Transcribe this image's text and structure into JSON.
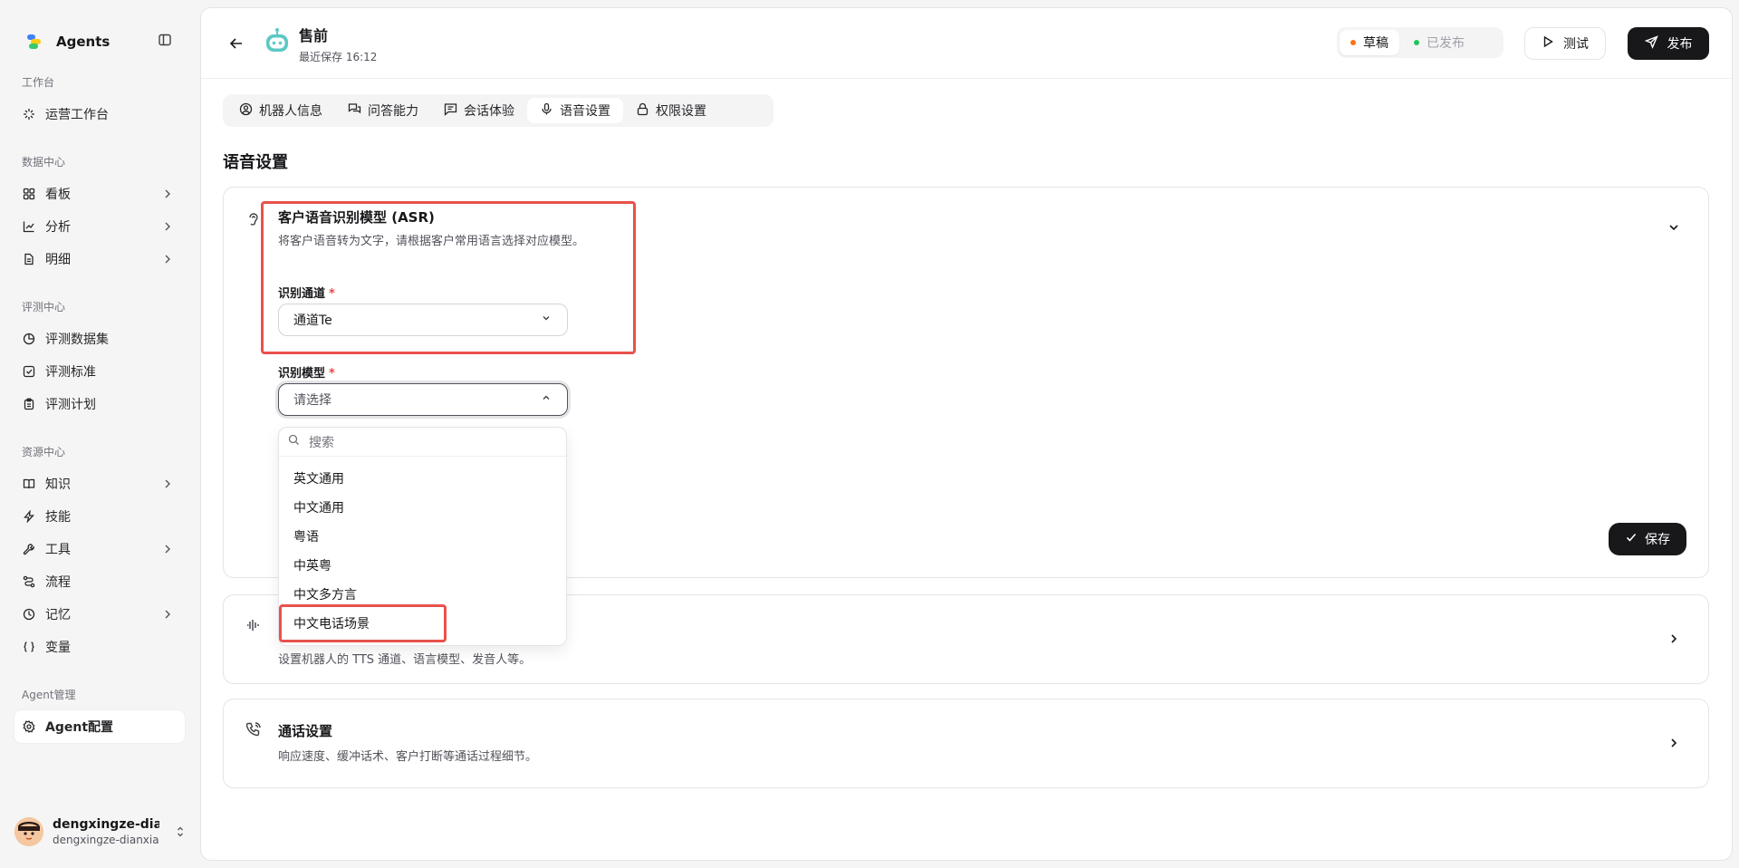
{
  "sidebar": {
    "brand": "Agents",
    "sections": {
      "workbench": "工作台",
      "data": "数据中心",
      "eval": "评测中心",
      "resources": "资源中心",
      "agent": "Agent管理"
    },
    "items": {
      "ops": "运营工作台",
      "board": "看板",
      "analysis": "分析",
      "details": "明细",
      "eval_dataset": "评测数据集",
      "eval_standard": "评测标准",
      "eval_plan": "评测计划",
      "knowledge": "知识",
      "skills": "技能",
      "tools": "工具",
      "flow": "流程",
      "memory": "记忆",
      "variables": "变量",
      "agent_config": "Agent配置"
    },
    "user": {
      "name": "dengxingze-dia...",
      "email": "dengxingze-dianxia..."
    }
  },
  "header": {
    "title": "售前",
    "subtitle": "最近保存 16:12",
    "status_draft": "草稿",
    "status_published": "已发布",
    "test_label": "测试",
    "publish_label": "发布",
    "colors": {
      "draft_dot": "#f97316",
      "published_dot": "#22c55e",
      "primary": "#18181b"
    }
  },
  "tabs": [
    "机器人信息",
    "问答能力",
    "会话体验",
    "语音设置",
    "权限设置"
  ],
  "page_title": "语音设置",
  "asr": {
    "title": "客户语音识别模型 (ASR)",
    "desc": "将客户语音转为文字，请根据客户常用语言选择对应模型。",
    "channel_label": "识别通道",
    "channel_value": "通道Te",
    "model_label": "识别模型",
    "model_placeholder": "请选择",
    "save_label": "保存",
    "dropdown": {
      "search_placeholder": "搜索",
      "options": [
        "英文通用",
        "中文通用",
        "粤语",
        "中英粤",
        "中文多方言",
        "中文电话场景"
      ]
    }
  },
  "tts": {
    "desc": "设置机器人的 TTS 通道、语言模型、发音人等。"
  },
  "call": {
    "title": "通话设置",
    "desc": "响应速度、缓冲话术、客户打断等通话过程细节。"
  },
  "required_mark": "*"
}
